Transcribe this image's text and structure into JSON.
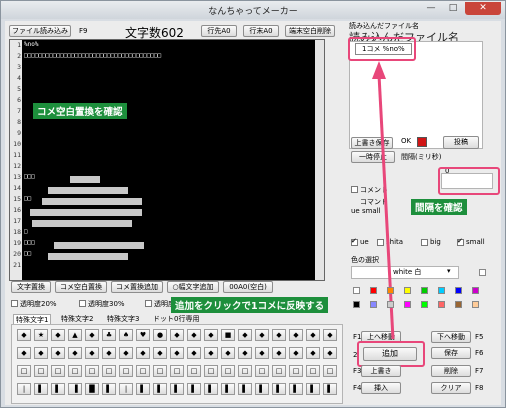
{
  "window": {
    "title": "なんちゃってメーカー"
  },
  "toolbar": {
    "load_button": "ファイル読み込み",
    "f9": "F9",
    "char_count": "文字数602",
    "line_head_button": "行先A0",
    "line_end_button": "行末A0",
    "trim_end_button": "端末空白削除"
  },
  "editor": {
    "line_numbers": [
      "1",
      "2",
      "3",
      "4",
      "5",
      "6",
      "7",
      "8",
      "9",
      "10",
      "11",
      "12",
      "13",
      "14",
      "15",
      "16",
      "17",
      "18",
      "19",
      "20",
      "21"
    ],
    "line1": "%no%",
    "line2": "□□□□□□□□□□□□□□□□□□□□□□□□□□□□□□□□□□□□□□",
    "line13": "□□□",
    "line15": "□□",
    "line18": "□",
    "line19": "□□□",
    "line20": "□□"
  },
  "bottom_buttons": {
    "b1": "文字置換",
    "b2": "コメ空白置換",
    "b3": "コメ置換追加",
    "b4": "○幅文字追加",
    "b5": "00A0(空白)"
  },
  "opacity": {
    "o1": "透明度20%",
    "o2": "透明度30%",
    "o3": "透明度"
  },
  "tabs": [
    "特殊文字1",
    "特殊文字2",
    "特殊文字3",
    "ドット0行専用"
  ],
  "symbols": [
    [
      "◆",
      "★",
      "◆",
      "▲",
      "◆",
      "♣",
      "♠",
      "♥",
      "●",
      "◆",
      "◆",
      "◆",
      "■",
      "◆",
      "◆",
      "◆",
      "◆",
      "◆",
      "◆"
    ],
    [
      "◆",
      "◆",
      "◆",
      "◆",
      "◆",
      "◆",
      "◆",
      "◆",
      "◆",
      "◆",
      "◆",
      "◆",
      "◆",
      "◆",
      "◆",
      "◆",
      "◆",
      "◆",
      "◆"
    ],
    [
      "□",
      "□",
      "□",
      "□",
      "□",
      "□",
      "□",
      "□",
      "□",
      "□",
      "□",
      "□",
      "□",
      "□",
      "□",
      "□",
      "□",
      "□",
      "□"
    ],
    [
      "|",
      "▌",
      "▌",
      "▐",
      "█",
      "▌",
      "|",
      "▌",
      "▌",
      "▌",
      "▌",
      "▌",
      "▌",
      "▌",
      "▌",
      "▌",
      "▌",
      "▌",
      "▌"
    ]
  ],
  "right_panel": {
    "file_label": "読み込んだファイル名",
    "file_value": "1コメ %no%",
    "overwrite_button": "上書き保存",
    "ok_label": "OK",
    "post_button": "投稿",
    "pause_button": "一時停止",
    "interval_label": "間隔(ミリ秒)",
    "interval_value": "0",
    "comment_cb": "コメント",
    "command_label": "コマンド",
    "command_value": "ue small",
    "pos_ue": "ue",
    "pos_shita": "shita",
    "size_big": "big",
    "size_small": "small",
    "color_label": "色の選択",
    "color_value": "white 白",
    "swatches": [
      "#ffffff",
      "#ff0000",
      "#ff8800",
      "#ffff00",
      "#00cc00",
      "#00ccff",
      "#0000ff",
      "#cc00cc",
      "#000000",
      "#8888ff",
      "#cccccc",
      "#ff00ff",
      "#00ff00",
      "#ff6666",
      "#996633",
      "#ffcc99"
    ]
  },
  "action_buttons": {
    "f1": "F1",
    "up": "上へ移動",
    "down": "下へ移動",
    "f5": "F5",
    "f2": "2",
    "add": "追加",
    "save": "保存",
    "f6": "F6",
    "f3": "F3",
    "overwrite": "上書き",
    "delete": "削除",
    "f7": "F7",
    "f4": "F4",
    "insert": "挿入",
    "clear": "クリア",
    "f8": "F8"
  },
  "annotations": {
    "a1": "コメ空白置換を確認",
    "a2": "間隔を確認",
    "a3": "追加をクリックで1コメに反映する"
  },
  "colors": {
    "accent_callout": "#e8477a",
    "annotation_bg": "#1d8f3c"
  }
}
